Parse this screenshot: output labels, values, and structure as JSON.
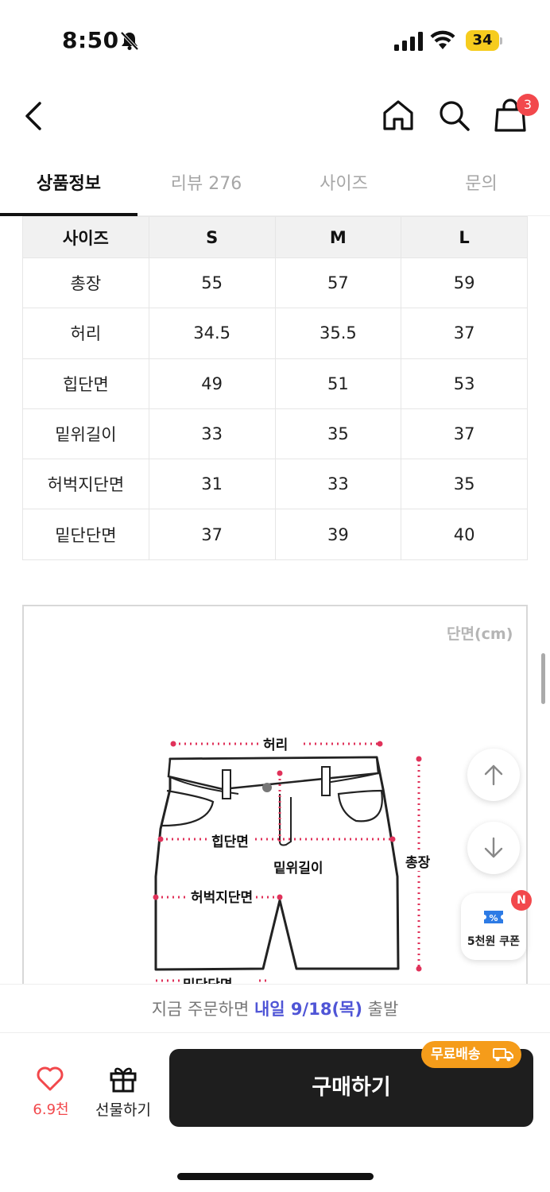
{
  "status_bar": {
    "time": "8:50",
    "battery": "34"
  },
  "header": {
    "cart_count": "3"
  },
  "tabs": [
    {
      "label": "상품정보"
    },
    {
      "label": "리뷰 276"
    },
    {
      "label": "사이즈"
    },
    {
      "label": "문의"
    }
  ],
  "size_table": {
    "headers": [
      "사이즈",
      "S",
      "M",
      "L"
    ],
    "rows": [
      [
        "총장",
        "55",
        "57",
        "59"
      ],
      [
        "허리",
        "34.5",
        "35.5",
        "37"
      ],
      [
        "힙단면",
        "49",
        "51",
        "53"
      ],
      [
        "밑위길이",
        "33",
        "35",
        "37"
      ],
      [
        "허벅지단면",
        "31",
        "33",
        "35"
      ],
      [
        "밑단단면",
        "37",
        "39",
        "40"
      ]
    ]
  },
  "diagram": {
    "unit": "단면(cm)",
    "labels": {
      "waist": "허리",
      "hip": "힙단면",
      "rise": "밑위길이",
      "thigh": "허벅지단면",
      "length": "총장",
      "hem": "밑단단면"
    }
  },
  "floating": {
    "coupon_label": "5천원 쿠폰",
    "coupon_badge": "N"
  },
  "delivery": {
    "prefix": "지금 주문하면 ",
    "highlight": "내일 9/18(목)",
    "suffix": " 출발"
  },
  "bottom_bar": {
    "like_count": "6.9천",
    "gift_label": "선물하기",
    "buy_label": "구매하기",
    "free_shipping": "무료배송"
  },
  "colors": {
    "accent_red": "#f2484c",
    "delivery_blue": "#4f55d6",
    "badge_orange": "#f59c1a",
    "buy_dark": "#1e1e1e"
  },
  "icons": [
    "bell-mute-icon",
    "signal-icon",
    "wifi-icon",
    "back-icon",
    "home-icon",
    "search-icon",
    "cart-icon",
    "arrow-up-icon",
    "arrow-down-icon",
    "coupon-icon",
    "heart-icon",
    "gift-icon",
    "truck-icon"
  ]
}
